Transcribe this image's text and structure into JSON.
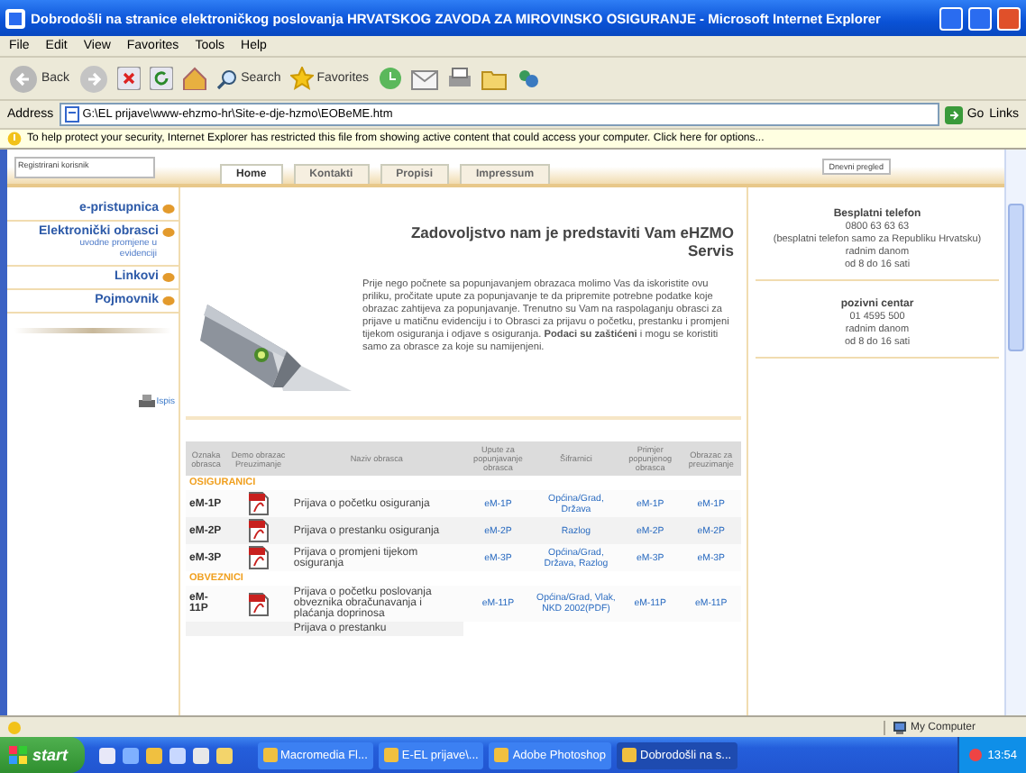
{
  "window": {
    "title": "Dobrodošli na stranice elektroničkog poslovanja HRVATSKOG ZAVODA ZA MIROVINSKO OSIGURANJE - Microsoft Internet Explorer"
  },
  "menu": [
    "File",
    "Edit",
    "View",
    "Favorites",
    "Tools",
    "Help"
  ],
  "toolbar": {
    "back": "Back",
    "search": "Search",
    "favorites": "Favorites"
  },
  "address": {
    "label": "Address",
    "value": "G:\\EL prijave\\www-ehzmo-hr\\Site-e-dje-hzmo\\EOBeME.htm",
    "go": "Go",
    "links": "Links"
  },
  "info_bar": "To help protect your security, Internet Explorer has restricted this file from showing active content that could access your computer. Click here for options...",
  "site": {
    "login": "Registrirani korisnik",
    "tabs": [
      {
        "label": "Home",
        "selected": true
      },
      {
        "label": "Kontakti",
        "selected": false
      },
      {
        "label": "Propisi",
        "selected": false
      },
      {
        "label": "Impressum",
        "selected": false
      }
    ],
    "header_note": "Dnevni pregled",
    "sidebar": [
      {
        "label": "e-pristupnica"
      },
      {
        "label": "Elektronički obrasci",
        "note": "uvodne promjene u evidenciji"
      },
      {
        "label": "Linkovi"
      },
      {
        "label": "Pojmovnik"
      }
    ],
    "print": "Ispis",
    "heading": "Zadovoljstvo nam je predstaviti Vam eHZMO Servis",
    "intro": "Prije nego počnete sa popunjavanjem obrazaca molimo Vas da iskoristite ovu priliku, pročitate upute za popunjavanje te da pripremite potrebne podatke koje obrazac zahtijeva za popunjavanje. Trenutno su Vam na raspolaganju obrasci za prijave u matičnu evidenciju i to Obrasci za prijavu o početku, prestanku i promjeni tijekom osiguranja i odjave s osiguranja. **Podaci su zaštićeni** i mogu se koristiti samo za obrasce za koje su namijenjeni.",
    "contacts": [
      {
        "title": "Besplatni telefon",
        "lines": [
          "0800 63 63 63",
          "(besplatni telefon samo za Republiku Hrvatsku)",
          "radnim danom",
          "od 8 do 16 sati"
        ]
      },
      {
        "title": "pozivni centar",
        "lines": [
          "01 4595 500",
          "radnim danom",
          "od 8 do 16 sati"
        ]
      }
    ],
    "table": {
      "columns": [
        "Oznaka obrasca",
        "Demo obrazac Preuzimanje",
        "Naziv obrasca",
        "Upute za popunjavanje obrasca",
        "Šifrarnici",
        "Primjer popunjenog obrasca",
        "Obrazac za preuzimanje"
      ],
      "groups": [
        {
          "name": "OSIGURANICI",
          "rows": [
            {
              "code": "eM-1P",
              "name": "Prijava o početku osiguranja",
              "links": [
                "eM-1P",
                "Općina/Grad, Država",
                "eM-1P",
                "eM-1P"
              ]
            },
            {
              "code": "eM-2P",
              "name": "Prijava o prestanku osiguranja",
              "links": [
                "eM-2P",
                "Razlog",
                "eM-2P",
                "eM-2P"
              ]
            },
            {
              "code": "eM-3P",
              "name": "Prijava o promjeni tijekom osiguranja",
              "links": [
                "eM-3P",
                "Općina/Grad, Država, Razlog",
                "eM-3P",
                "eM-3P"
              ]
            }
          ]
        },
        {
          "name": "OBVEZNICI",
          "rows": [
            {
              "code": "eM-11P",
              "name": "Prijava o početku poslovanja obveznika obračunavanja i plaćanja doprinosa",
              "links": [
                "eM-11P",
                "Općina/Grad, Vlak, NKD 2002(PDF)",
                "eM-11P",
                "eM-11P"
              ]
            }
          ]
        }
      ],
      "cut_row": "Prijava o prestanku"
    }
  },
  "status_bar": "My Computer",
  "taskbar": {
    "start": "start",
    "tasks": [
      {
        "label": "Macromedia Fl...",
        "selected": false
      },
      {
        "label": "E-EL prijave\\...",
        "selected": false
      },
      {
        "label": "Adobe Photoshop",
        "selected": false
      },
      {
        "label": "Dobrodošli na s...",
        "selected": true
      }
    ],
    "clock": "13:54"
  }
}
